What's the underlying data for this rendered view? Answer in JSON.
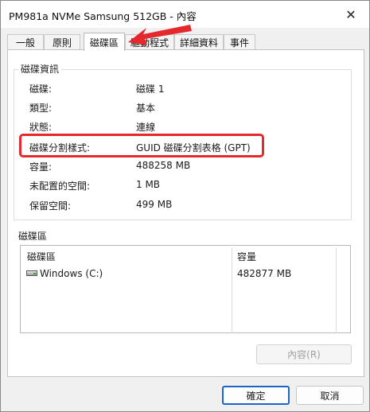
{
  "window": {
    "title": "PM981a NVMe Samsung 512GB - 內容",
    "close_glyph": "✕"
  },
  "tabs": [
    "一般",
    "原則",
    "磁碟區",
    "驅動程式",
    "詳細資料",
    "事件"
  ],
  "active_tab_index": 2,
  "disk_info": {
    "group_title": "磁碟資訊",
    "rows": [
      {
        "label": "磁碟:",
        "value": "磁碟 1"
      },
      {
        "label": "類型:",
        "value": "基本"
      },
      {
        "label": "狀態:",
        "value": "連線"
      },
      {
        "label": "磁碟分割樣式:",
        "value": "GUID 磁碟分割表格 (GPT)"
      },
      {
        "label": "容量:",
        "value": "488258 MB"
      },
      {
        "label": "未配置的空間:",
        "value": "1 MB"
      },
      {
        "label": "保留空間:",
        "value": "499 MB"
      }
    ]
  },
  "volumes": {
    "section_label": "磁碟區",
    "columns": [
      "磁碟區",
      "容量"
    ],
    "rows": [
      {
        "name": "Windows (C:)",
        "capacity": "482877 MB",
        "icon": "drive-icon"
      }
    ]
  },
  "buttons": {
    "properties": "內容(R)",
    "ok": "確定",
    "cancel": "取消"
  },
  "annotation": {
    "highlight_color": "#e5282e",
    "arrow_color": "#e5282e"
  }
}
